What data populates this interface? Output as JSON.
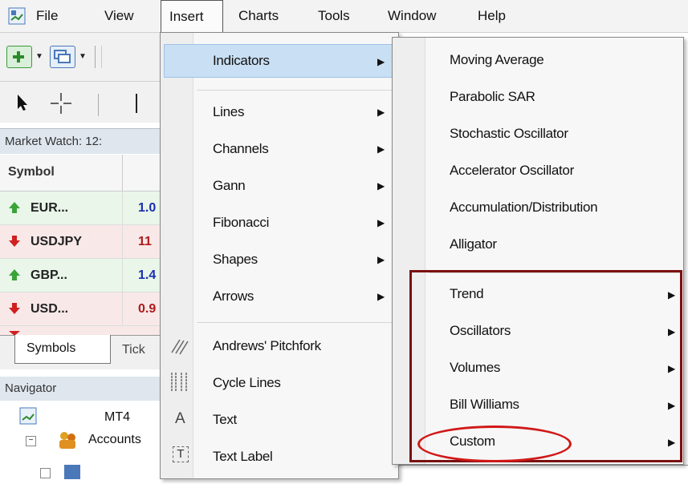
{
  "menubar": {
    "items": [
      "File",
      "View",
      "Insert",
      "Charts",
      "Tools",
      "Window",
      "Help"
    ]
  },
  "market_watch": {
    "title": "Market Watch: 12:",
    "column_symbol": "Symbol",
    "rows": [
      {
        "symbol": "EUR...",
        "value": "1.0",
        "direction": "up",
        "value_color": "#1a2fb0"
      },
      {
        "symbol": "USDJPY",
        "value": "11",
        "direction": "down",
        "value_color": "#b01a1a"
      },
      {
        "symbol": "GBP...",
        "value": "1.4",
        "direction": "up",
        "value_color": "#1a2fb0"
      },
      {
        "symbol": "USD...",
        "value": "0.9",
        "direction": "down",
        "value_color": "#b01a1a"
      }
    ],
    "tabs": [
      "Symbols",
      "Tick"
    ]
  },
  "navigator": {
    "title": "Navigator",
    "root": "MT4",
    "accounts": "Accounts"
  },
  "insert_menu": {
    "items": [
      {
        "label": "Indicators",
        "submenu": true,
        "highlighted": true
      },
      {
        "label": "Lines",
        "submenu": true
      },
      {
        "label": "Channels",
        "submenu": true
      },
      {
        "label": "Gann",
        "submenu": true
      },
      {
        "label": "Fibonacci",
        "submenu": true
      },
      {
        "label": "Shapes",
        "submenu": true
      },
      {
        "label": "Arrows",
        "submenu": true
      },
      {
        "label": "Andrews' Pitchfork",
        "icon": "pitchfork-icon"
      },
      {
        "label": "Cycle Lines",
        "icon": "cycle-lines-icon"
      },
      {
        "label": "Text",
        "icon": "text-icon",
        "icon_glyph": "A"
      },
      {
        "label": "Text Label",
        "icon": "text-label-icon",
        "icon_glyph": "T"
      }
    ]
  },
  "indicators_menu": {
    "items": [
      {
        "label": "Moving Average"
      },
      {
        "label": "Parabolic SAR"
      },
      {
        "label": "Stochastic Oscillator"
      },
      {
        "label": "Accelerator Oscillator"
      },
      {
        "label": "Accumulation/Distribution"
      },
      {
        "label": "Alligator"
      },
      {
        "label": "Trend",
        "submenu": true
      },
      {
        "label": "Oscillators",
        "submenu": true
      },
      {
        "label": "Volumes",
        "submenu": true
      },
      {
        "label": "Bill Williams",
        "submenu": true
      },
      {
        "label": "Custom",
        "submenu": true
      }
    ]
  },
  "colors": {
    "highlight_box": "#7a1010",
    "highlight_ellipse": "#d01818",
    "selected_item": "#c9dff3"
  }
}
